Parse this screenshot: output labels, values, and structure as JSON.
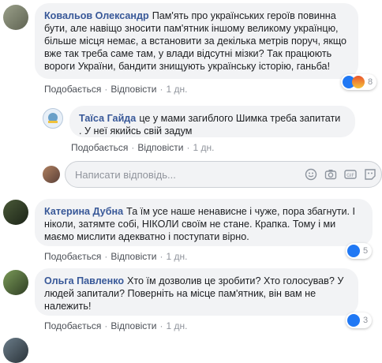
{
  "comments": [
    {
      "author": "Ковальов Олександр",
      "text": "Пам'ять про українських героїв повинна бути, але навіщо зносити пам'ятник іншому великому українцю, більше місця немає, а встановити за декілька метрів поруч, якщо вже так треба саме там, у влади відсутні мізки? Так працюють вороги України, бандити знищують українську історію, ганьба!",
      "like": "Подобається",
      "reply": "Відповісти",
      "time": "1 дн.",
      "reactions": "8"
    },
    {
      "author": "Таїса Гайда",
      "text": "це у мами загиблого Шимка треба запитати . У неї якийсь свій задум",
      "like": "Подобається",
      "reply": "Відповісти",
      "time": "1 дн."
    },
    {
      "author": "Катерина Дубна",
      "text": "Та їм усе наше ненависне і чуже, пора збагнути. І ніколи, затямте собі, НІКОЛИ своїм не стане. Крапка. Тому і ми маємо мислити адекватно і поступати вірно.",
      "like": "Подобається",
      "reply": "Відповісти",
      "time": "1 дн.",
      "reactions": "5"
    },
    {
      "author": "Ольга Павленко",
      "text": "Хто їм дозволив це зробити? Хто голосував? У людей запитали? Поверніть на місце пам'ятник, він вам не належить!",
      "like": "Подобається",
      "reply": "Відповісти",
      "time": "1 дн.",
      "reactions": "3"
    }
  ],
  "reply_box": {
    "placeholder": "Написати відповідь..."
  },
  "icons": [
    "emoji-icon",
    "camera-icon",
    "gif-icon",
    "sticker-icon"
  ],
  "colors": {
    "link": "#385898",
    "bubble": "#f2f3f5",
    "meta": "#90949c"
  }
}
